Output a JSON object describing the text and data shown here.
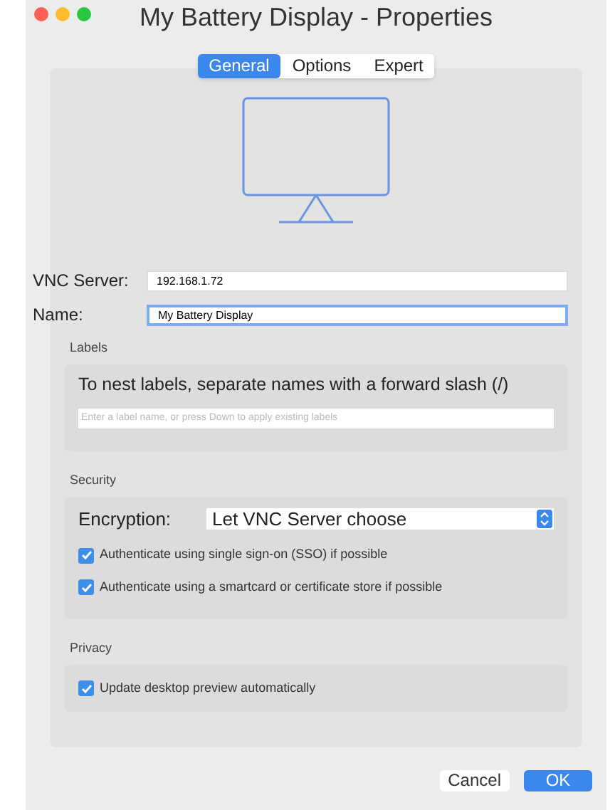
{
  "window": {
    "title": "My Battery Display - Properties"
  },
  "tabs": [
    {
      "label": "General",
      "selected": true
    },
    {
      "label": "Options",
      "selected": false
    },
    {
      "label": "Expert",
      "selected": false
    }
  ],
  "fields": [
    {
      "label": "VNC Server:",
      "value": "192.168.1.72",
      "focused": false
    },
    {
      "label": "Name:",
      "value": "My Battery Display",
      "focused": true
    }
  ],
  "labels": {
    "heading": "Labels",
    "hint": "To nest labels, separate names with a forward slash (/)",
    "placeholder": "Enter a label name, or press Down to apply existing labels"
  },
  "security": {
    "heading": "Security",
    "encryption_label": "Encryption:",
    "encryption_value": "Let VNC Server choose",
    "options": [
      {
        "label": "Authenticate using single sign-on (SSO) if possible",
        "checked": true
      },
      {
        "label": "Authenticate using a smartcard or certificate store if possible",
        "checked": true
      }
    ]
  },
  "privacy": {
    "heading": "Privacy",
    "options": [
      {
        "label": "Update desktop preview automatically",
        "checked": true
      }
    ]
  },
  "buttons": [
    {
      "label": "Cancel",
      "kind": "secondary"
    },
    {
      "label": "OK",
      "kind": "primary"
    }
  ]
}
